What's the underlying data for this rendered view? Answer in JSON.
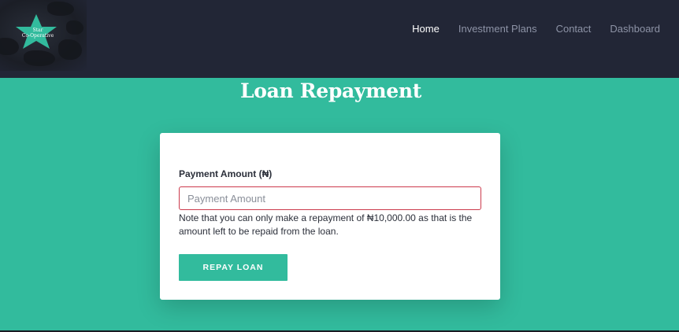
{
  "logo": {
    "line1": "Star",
    "line2": "Co-Operative",
    "star_color": "#32bb9d"
  },
  "nav": {
    "items": [
      {
        "label": "Home",
        "active": true
      },
      {
        "label": "Investment Plans",
        "active": false
      },
      {
        "label": "Contact",
        "active": false
      },
      {
        "label": "Dashboard",
        "active": false
      }
    ]
  },
  "page": {
    "title": "Loan Repayment"
  },
  "form": {
    "amount_label": "Payment Amount (₦)",
    "amount_placeholder": "Payment Amount",
    "amount_value": "",
    "note": "Note that you can only make a repayment of ₦10,000.00 as that is the amount left to be repaid from the loan.",
    "submit_label": "REPAY LOAN"
  },
  "colors": {
    "navbar_bg": "#222636",
    "accent": "#32bb9d",
    "input_border": "#cc3a4c"
  }
}
